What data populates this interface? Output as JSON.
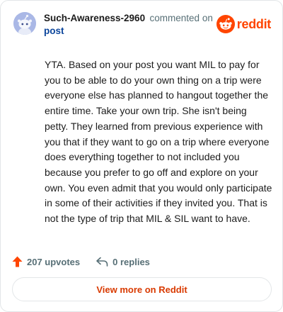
{
  "comment": {
    "username": "Such-Awareness-2960",
    "action_text": "commented on",
    "post_link_text": "post",
    "body": "YTA. Based on your post you want MIL to pay for you to be able to do your own thing on a trip were everyone else has planned to hangout together the entire time. Take your own trip. She isn't being petty. They learned from previous experience with you that if they want to go on a trip where everyone does everything together to not included you because you prefer to go off and explore on your own. You even admit that you would only participate in some of their activities if they invited you. That is not the type of trip that MIL & SIL want to have.",
    "upvotes": "207 upvotes",
    "replies": "0 replies"
  },
  "brand": {
    "wordmark": "reddit",
    "color": "#ff4500"
  },
  "actions": {
    "view_more_label": "View more on Reddit"
  },
  "icons": {
    "avatar": "snoo-avatar-icon",
    "logo": "reddit-logo-icon",
    "upvote": "upvote-arrow-icon",
    "reply": "reply-arrow-icon"
  },
  "colors": {
    "upvote": "#ff4500",
    "link": "#0a449b",
    "muted": "#576f76",
    "view_more": "#d93a00",
    "avatar_bg": "#aab8e6"
  }
}
